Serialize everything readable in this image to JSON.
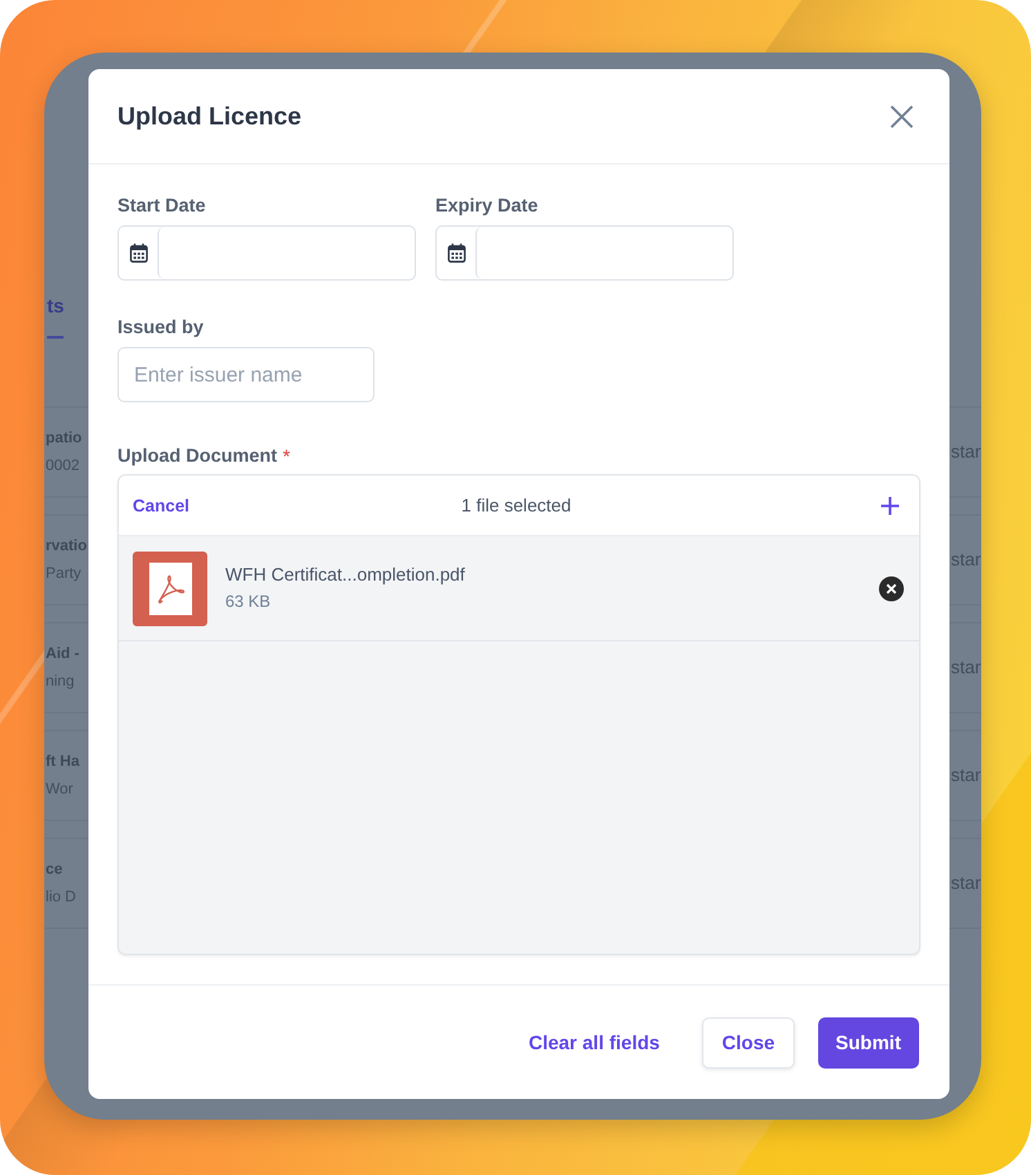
{
  "background_app": {
    "tab": {
      "label": "ts",
      "selected": true
    },
    "rows": [
      {
        "title": "patio",
        "subtitle": "0002",
        "trailing": "star"
      },
      {
        "title": "rvatio",
        "subtitle": "Party",
        "trailing": "star"
      },
      {
        "title": "Aid -",
        "subtitle": "ning",
        "trailing": "star"
      },
      {
        "title": "ft Ha",
        "subtitle": "Wor",
        "trailing": "star"
      },
      {
        "title": "ce",
        "subtitle": "lio D",
        "trailing": "star"
      }
    ]
  },
  "dialog": {
    "title": "Upload Licence",
    "date_fields": [
      {
        "label": "Start Date"
      },
      {
        "label": "Expiry Date"
      }
    ],
    "issued_by": {
      "label": "Issued by",
      "placeholder": "Enter issuer name"
    },
    "upload": {
      "label": "Upload Document",
      "required_mark": "*",
      "cancel": "Cancel",
      "status": "1 file selected",
      "files": [
        {
          "kind": "pdf",
          "name": "WFH Certificat...ompletion.pdf",
          "size": "63 KB"
        }
      ]
    },
    "buttons": [
      {
        "kind": "link",
        "label": "Clear all fields"
      },
      {
        "kind": "secondary",
        "label": "Close"
      },
      {
        "kind": "primary",
        "label": "Submit"
      }
    ]
  }
}
